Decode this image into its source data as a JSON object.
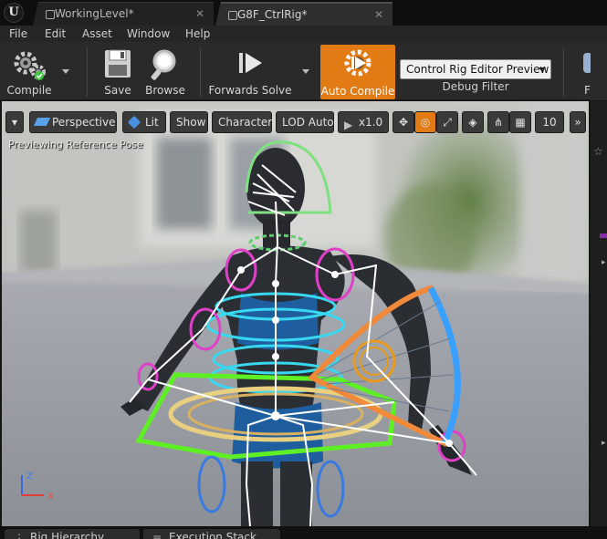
{
  "tabs": [
    {
      "label": "WorkingLevel*",
      "active": false
    },
    {
      "label": "G8F_CtrlRig*",
      "active": true
    }
  ],
  "menu": [
    "File",
    "Edit",
    "Asset",
    "Window",
    "Help"
  ],
  "toolbar": {
    "compile": "Compile",
    "save": "Save",
    "browse": "Browse",
    "forwards_solve": "Forwards Solve",
    "auto_compile": "Auto Compile",
    "debug_select_value": "Control Rig Editor Preview",
    "debug_filter": "Debug Filter",
    "find": "Find"
  },
  "viewport": {
    "perspective": "Perspective",
    "lit": "Lit",
    "show": "Show",
    "character": "Character",
    "lod": "LOD Auto",
    "speed": "x1.0",
    "grid_size": "10",
    "caption": "Previewing Reference Pose",
    "axis_z": "Z",
    "axis_x": "X"
  },
  "bottom_tabs": [
    "Rig Hierarchy",
    "Execution Stack"
  ],
  "colors": {
    "accent": "#e37b14",
    "control_green": "#5ef024",
    "control_magenta": "#e040c8",
    "control_cyan": "#38d8f0",
    "control_orange": "#f08a3a"
  },
  "icons": {
    "compile": "gears-icon",
    "save": "floppy-disk-icon",
    "browse": "magnifier-icon",
    "forwards_solve": "play-icon",
    "auto_compile": "gears-play-icon",
    "find": "binoculars-icon"
  }
}
